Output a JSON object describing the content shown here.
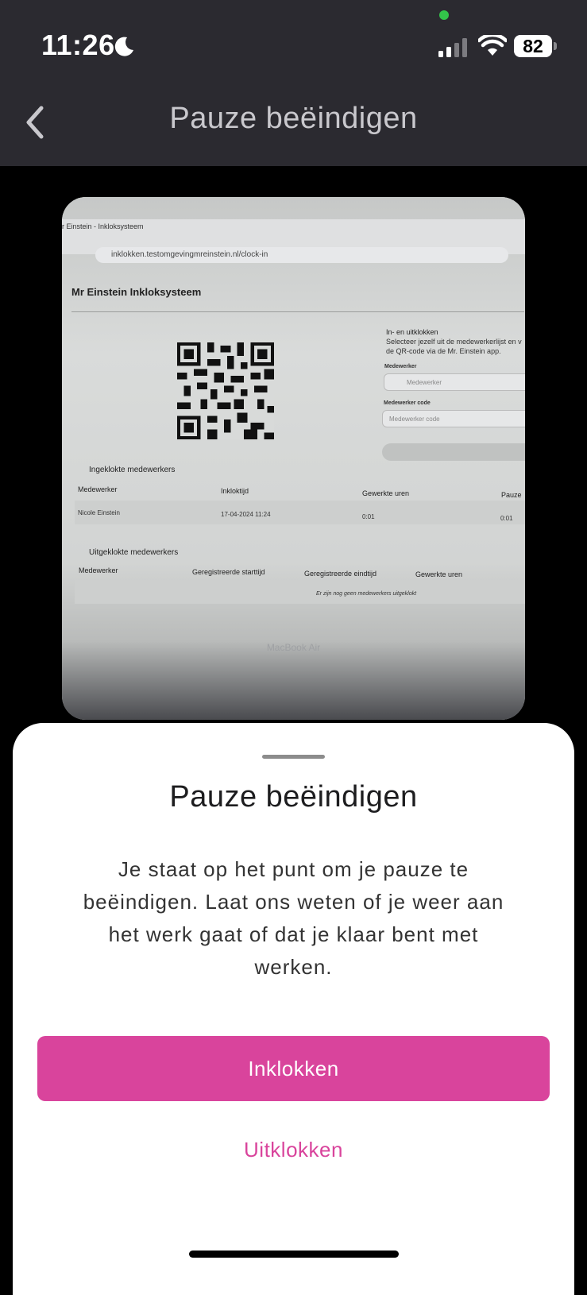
{
  "status_bar": {
    "time": "11:26",
    "battery": "82"
  },
  "nav": {
    "title": "Pauze beëindigen"
  },
  "camera_view": {
    "browser_tab": "r Einstein - Inkloksysteem",
    "url": "inklokken.testomgevingmreinstein.nl/clock-in",
    "page_title": "Mr Einstein Inkloksysteem",
    "inout_title": "In- en uitklokken",
    "inout_desc": "Selecteer jezelf uit de medewerkerlijst en v de QR-code via de Mr. Einstein app.",
    "employee_label": "Medewerker",
    "employee_placeholder": "Medewerker",
    "code_label": "Medewerker code",
    "code_placeholder": "Medewerker code",
    "clocked_in_title": "Ingeklokte medewerkers",
    "clocked_in_cols": [
      "Medewerker",
      "Inkloktijd",
      "Gewerkte uren",
      "Pauze"
    ],
    "clocked_in_row": [
      "Nicole Einstein",
      "17-04-2024 11:24",
      "0:01",
      "0:01"
    ],
    "clocked_out_title": "Uitgeklokte medewerkers",
    "clocked_out_cols": [
      "Medewerker",
      "Geregistreerde starttijd",
      "Geregistreerde eindtijd",
      "Gewerkte uren"
    ],
    "clocked_out_empty": "Er zijn nog geen medewerkers uitgeklokt",
    "laptop_label": "MacBook Air"
  },
  "sheet": {
    "title": "Pauze beëindigen",
    "message": "Je staat op het punt om je pauze te beëindigen. Laat ons weten of je weer aan het werk gaat of dat je klaar bent met werken.",
    "primary_label": "Inklokken",
    "secondary_label": "Uitklokken"
  },
  "colors": {
    "accent": "#d9449c",
    "nav_bg": "#2b2a30"
  }
}
